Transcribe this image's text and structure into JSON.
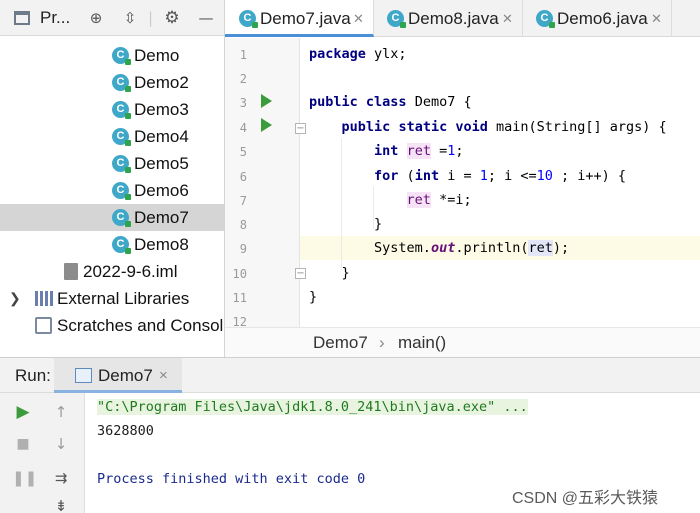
{
  "project_panel": {
    "title": "Pr...",
    "toolbar_icons": [
      "project-view-icon",
      "locate-target-icon",
      "collapse-all-icon",
      "gear-icon",
      "hide-panel-icon"
    ],
    "tree": [
      {
        "label": "Demo",
        "type": "class"
      },
      {
        "label": "Demo2",
        "type": "class"
      },
      {
        "label": "Demo3",
        "type": "class"
      },
      {
        "label": "Demo4",
        "type": "class"
      },
      {
        "label": "Demo5",
        "type": "class"
      },
      {
        "label": "Demo6",
        "type": "class"
      },
      {
        "label": "Demo7",
        "type": "class",
        "selected": true
      },
      {
        "label": "Demo8",
        "type": "class"
      },
      {
        "label": "2022-9-6.iml",
        "type": "iml"
      },
      {
        "label": "External Libraries",
        "type": "library"
      },
      {
        "label": "Scratches and Consoles",
        "type": "scratch"
      }
    ]
  },
  "editor_tabs": [
    {
      "label": "Demo7.java",
      "active": true
    },
    {
      "label": "Demo8.java",
      "active": false
    },
    {
      "label": "Demo6.java",
      "active": false
    }
  ],
  "editor": {
    "line_numbers": [
      "1",
      "2",
      "3",
      "4",
      "5",
      "6",
      "7",
      "8",
      "9",
      "10",
      "11",
      "12"
    ],
    "code": {
      "l1_kw": "package",
      "l1_rest": " ylx;",
      "l3_kw1": "public",
      "l3_kw2": "class",
      "l3_rest": " Demo7 {",
      "l4_kw1": "public",
      "l4_kw2": "static",
      "l4_kw3": "void",
      "l4_rest": " main(String[] args) {",
      "l5_kw": "int",
      "l5_var": "ret",
      "l5_op": " =",
      "l5_num": "1",
      "l5_end": ";",
      "l6_kw1": "for",
      "l6_p1": " (",
      "l6_kw2": "int",
      "l6_p2": " i = ",
      "l6_num1": "1",
      "l6_p3": "; i <=",
      "l6_num2": "10",
      "l6_p4": " ; i++) {",
      "l7_var": "ret",
      "l7_rest": " *=i;",
      "l8": "}",
      "l9_a": "System.",
      "l9_out": "out",
      "l9_b": ".println(",
      "l9_var": "ret",
      "l9_c": ");",
      "l10": "}",
      "l11": "}"
    }
  },
  "breadcrumb": {
    "class": "Demo7",
    "separator": "›",
    "method": "main()"
  },
  "run_panel": {
    "label": "Run:",
    "tab_label": "Demo7",
    "tab_close": "×",
    "console": {
      "command": "\"C:\\Program Files\\Java\\jdk1.8.0_241\\bin\\java.exe\" ...",
      "output": "3628800",
      "exit": "Process finished with exit code 0"
    }
  },
  "watermark": "CSDN @五彩大铁猿",
  "colors": {
    "run_green": "#3c9b3c",
    "class_icon": "#3fa8c9",
    "keyword": "#000080",
    "number": "#0000ff",
    "field": "#660e7a"
  }
}
